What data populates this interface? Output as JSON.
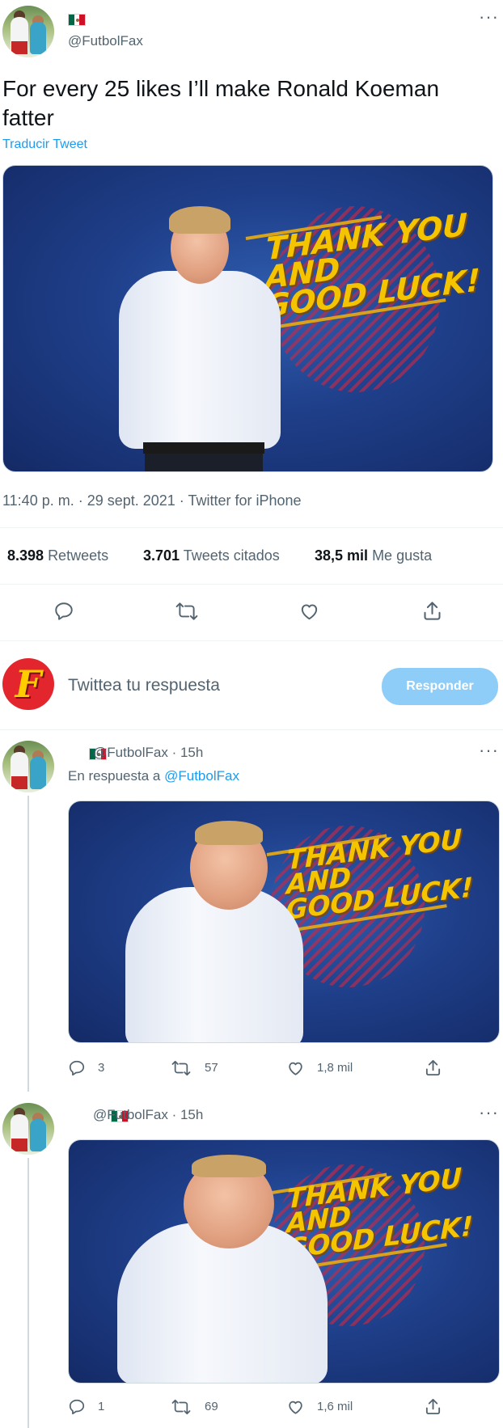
{
  "main_tweet": {
    "handle": "@FutbolFax",
    "text": "For every 25 likes I’ll make Ronald Koeman fatter",
    "translate": "Traducir Tweet",
    "image_text": "THANK YOU\nAND\nGOOD LUCK!",
    "meta": "11:40 p. m. · 29 sept. 2021 · Twitter for iPhone",
    "stats": [
      {
        "num": "8.398",
        "label": "Retweets"
      },
      {
        "num": "3.701",
        "label": "Tweets citados"
      },
      {
        "num": "38,5 mil",
        "label": "Me gusta"
      }
    ]
  },
  "composer": {
    "avatar_letter": "F",
    "placeholder": "Twittea tu respuesta",
    "button": "Responder"
  },
  "replies": [
    {
      "handle": "@FutbolFax",
      "time": "· 15h",
      "reply_to_label": "En respuesta a",
      "reply_to_handle": "@FutbolFax",
      "image_text": "THANK YOU\nAND\nGOOD LUCK!",
      "replies": "3",
      "retweets": "57",
      "likes": "1,8 mil"
    },
    {
      "handle": "@FutbolFax",
      "time": "· 15h",
      "image_text": "THANK YOU\nAND\nGOOD LUCK!",
      "replies": "1",
      "retweets": "69",
      "likes": "1,6 mil"
    }
  ],
  "colors": {
    "accent": "#1d9bf0",
    "button_disabled": "#8ecdf8",
    "composer_avatar": "#e3262d",
    "composer_letter": "#ffcc00"
  }
}
